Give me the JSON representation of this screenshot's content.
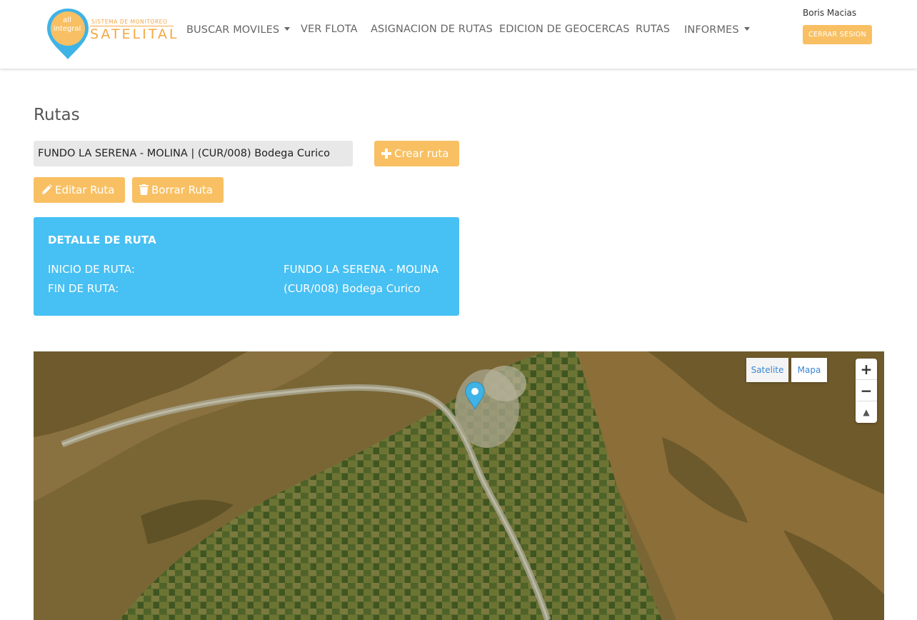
{
  "header": {
    "logo": {
      "pin_text_top": "all",
      "pin_text_bottom": "integral",
      "tagline": "SISTEMA DE MONITOREO",
      "brand": "SATELITAL"
    },
    "nav": [
      {
        "label": "BUSCAR MOVILES",
        "dropdown": true
      },
      {
        "label": "VER FLOTA",
        "dropdown": false
      },
      {
        "label": "ASIGNACION DE RUTAS",
        "dropdown": false
      },
      {
        "label": "EDICION DE GEOCERCAS",
        "dropdown": false
      },
      {
        "label": "RUTAS",
        "dropdown": false
      },
      {
        "label": "INFORMES",
        "dropdown": true
      }
    ],
    "user_name": "Boris Macias",
    "logout_label": "CERRAR SESION"
  },
  "page": {
    "title": "Rutas",
    "route_select_value": "FUNDO LA SERENA - MOLINA | (CUR/008) Bodega Curico",
    "create_label": "Crear ruta",
    "edit_label": "Editar Ruta",
    "delete_label": "Borrar Ruta"
  },
  "detail": {
    "title": "DETALLE DE RUTA",
    "start_label": "INICIO DE RUTA:",
    "start_value": "FUNDO LA SERENA - MOLINA",
    "end_label": "FIN DE RUTA:",
    "end_value": "(CUR/008) Bodega Curico"
  },
  "map": {
    "satellite_label": "Satelite",
    "map_label": "Mapa",
    "zoom_in": "+",
    "zoom_out": "−",
    "compass": "▲"
  },
  "colors": {
    "accent": "#f8c063",
    "detail_bg": "#47c0f3",
    "logo_blue": "#3fb3e6"
  }
}
